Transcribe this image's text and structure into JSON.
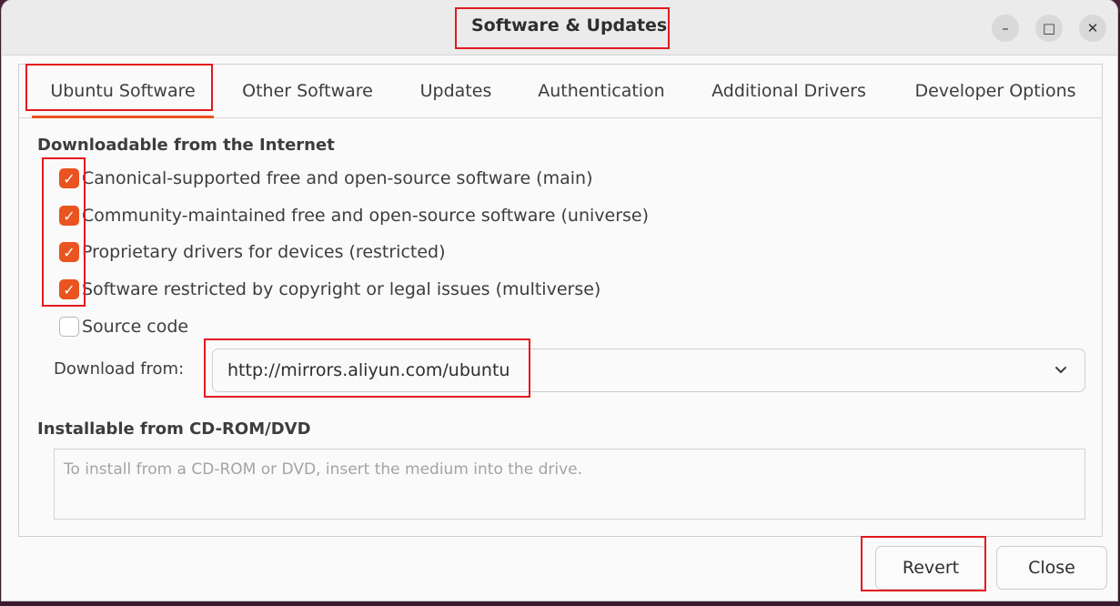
{
  "window": {
    "title": "Software & Updates",
    "controls": {
      "minimize": "–",
      "maximize": "□",
      "close": "✕"
    }
  },
  "tabs": [
    {
      "label": "Ubuntu Software",
      "active": true
    },
    {
      "label": "Other Software",
      "active": false
    },
    {
      "label": "Updates",
      "active": false
    },
    {
      "label": "Authentication",
      "active": false
    },
    {
      "label": "Additional Drivers",
      "active": false
    },
    {
      "label": "Developer Options",
      "active": false
    }
  ],
  "downloadable": {
    "heading": "Downloadable from the Internet",
    "options": [
      {
        "label": "Canonical-supported free and open-source software (main)",
        "checked": true
      },
      {
        "label": "Community-maintained free and open-source software (universe)",
        "checked": true
      },
      {
        "label": "Proprietary drivers for devices (restricted)",
        "checked": true
      },
      {
        "label": "Software restricted by copyright or legal issues (multiverse)",
        "checked": true
      },
      {
        "label": "Source code",
        "checked": false
      }
    ],
    "download_from_label": "Download from:",
    "download_from_value": "http://mirrors.aliyun.com/ubuntu"
  },
  "cdrom": {
    "heading": "Installable from CD-ROM/DVD",
    "placeholder": "To install from a CD-ROM or DVD, insert the medium into the drive."
  },
  "buttons": {
    "revert": "Revert",
    "close": "Close"
  },
  "colors": {
    "accent": "#e95420",
    "annotation": "#e3191f"
  },
  "icons": {
    "checkbox_checked": "check-icon",
    "dropdown": "chevron-down-icon"
  }
}
